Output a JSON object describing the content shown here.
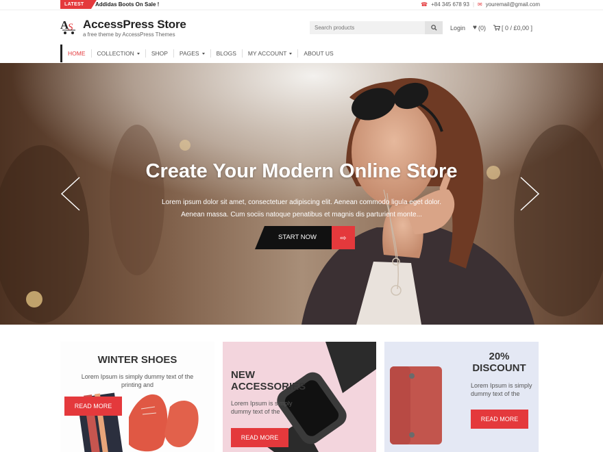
{
  "topbar": {
    "badge": "LATEST",
    "ticker": "Addidas Boots On Sale !",
    "phone": "+84 345 678 93",
    "email": "youremail@gmail.com"
  },
  "header": {
    "logo_text": "AS",
    "site_title": "AccessPress Store",
    "tagline": "a free theme by AccessPress Themes",
    "search_placeholder": "Search products",
    "login": "Login",
    "wishlist": "(0)",
    "cart": "[ 0 / £0,00 ]"
  },
  "nav": [
    {
      "label": "HOME",
      "active": true,
      "dropdown": false
    },
    {
      "label": "COLLECTION",
      "active": false,
      "dropdown": true
    },
    {
      "label": "SHOP",
      "active": false,
      "dropdown": false
    },
    {
      "label": "PAGES",
      "active": false,
      "dropdown": true
    },
    {
      "label": "BLOGS",
      "active": false,
      "dropdown": false
    },
    {
      "label": "MY ACCOUNT",
      "active": false,
      "dropdown": true
    },
    {
      "label": "ABOUT US",
      "active": false,
      "dropdown": false
    }
  ],
  "hero": {
    "title": "Create Your Modern Online Store",
    "text": "Lorem ipsum dolor sit amet, consectetuer adipiscing elit. Aenean commodo ligula eget dolor. Aenean massa. Cum sociis natoque penatibus et magnis dis parturient monte...",
    "button": "START NOW",
    "arrow_icon": "arrow-right-icon"
  },
  "promos": [
    {
      "title": "WINTER SHOES",
      "text": "Lorem Ipsum is simply dummy text of the printing and",
      "button": "READ MORE"
    },
    {
      "title_line1": "NEW",
      "title_line2": "ACCESSORIES",
      "text": "Lorem Ipsum is simply dummy text of the",
      "button": "READ MORE"
    },
    {
      "title_line1": "20%",
      "title_line2": "DISCOUNT",
      "text": "Lorem Ipsum is simply dummy text of the",
      "button": "READ MORE"
    }
  ],
  "colors": {
    "accent": "#e4393c",
    "dark": "#111111"
  }
}
